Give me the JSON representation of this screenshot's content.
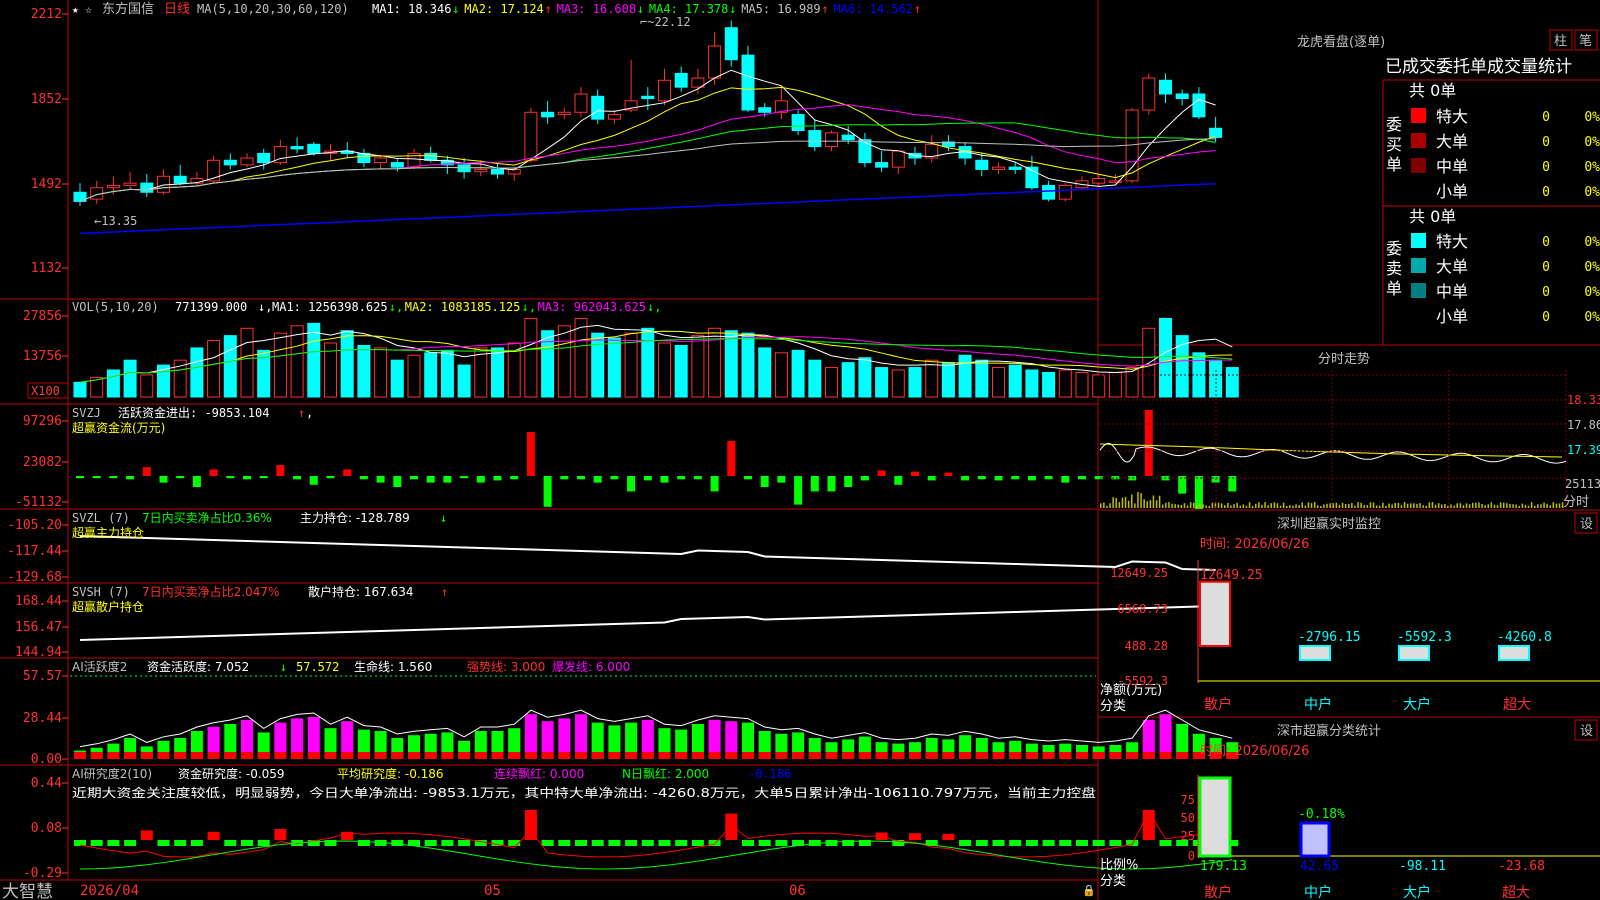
{
  "main_chart": {
    "stock_name": "东方国信",
    "period": "日线",
    "ma_params": "MA(5,10,20,30,60,120)",
    "ma_readouts": [
      {
        "label": "MA1: 18.346",
        "arrow": "↓",
        "color": "#ffffff"
      },
      {
        "label": "MA2: 17.124",
        "arrow": "↑",
        "color": "#ffff00"
      },
      {
        "label": "MA3: 16.608",
        "arrow": "↓",
        "color": "#ff00ff"
      },
      {
        "label": "MA4: 17.378",
        "arrow": "↓",
        "color": "#00ff00"
      },
      {
        "label": "MA5: 16.989",
        "arrow": "↑",
        "color": "#c0c0c0"
      },
      {
        "label": "MA6: 14.562",
        "arrow": "↑",
        "color": "#0000ff"
      }
    ],
    "y_ticks": [
      "2212",
      "1852",
      "1492",
      "1132"
    ],
    "annotation_high": "22.12",
    "annotation_low": "13.35"
  },
  "volume_panel": {
    "title": "VOL(5,10,20)",
    "value": "771399.000",
    "readouts": [
      {
        "label": "MA1: 1256398.625",
        "arrow": "↓",
        "color": "#ffffff"
      },
      {
        "label": "MA2: 1083185.125",
        "arrow": "↓",
        "color": "#ffff00"
      },
      {
        "label": "MA3: 962043.625",
        "arrow": "↓",
        "color": "#ff00ff"
      }
    ],
    "y_ticks": [
      "27856",
      "13756"
    ],
    "unit_badge": "X100"
  },
  "svzj_panel": {
    "title": "SVZJ",
    "label": "活跃资金进出: -9853.104",
    "arrow": "↑",
    "subtitle": "超赢资金流(万元)",
    "y_ticks": [
      "97296",
      "23082",
      "-51132"
    ]
  },
  "svzl_panel": {
    "title": "SVZL (7)",
    "part1": "7日内买卖净占比0.36%",
    "part2": "主力持仓: -128.789",
    "arrow": "↓",
    "subtitle": "超赢主力持仓",
    "y_ticks": [
      "-105.20",
      "-117.44",
      "-129.68"
    ]
  },
  "svsh_panel": {
    "title": "SVSH (7)",
    "part1": "7日内买卖净占比2.047%",
    "part2": "散户持仓: 167.634",
    "arrow": "↑",
    "subtitle": "超赢散户持仓",
    "y_ticks": [
      "168.44",
      "156.47",
      "144.94"
    ]
  },
  "ai_activity_panel": {
    "title": "AI活跃度2",
    "label": "资金活跃度: 7.052",
    "arrow": "↓",
    "value2": "57.572",
    "life_line": "生命线: 1.560",
    "strong_line": "强势线: 3.000",
    "burst_line": "爆发线: 6.000",
    "y_ticks": [
      "57.57",
      "28.44",
      "0.00"
    ]
  },
  "ai_research_panel": {
    "title": "AI研究度2(10)",
    "research": "资金研究度: -0.059",
    "avg": "平均研究度: -0.186",
    "cont": "连续飘红: 0.000",
    "nday": "N日飘红: 2.000",
    "last": "-0.186",
    "commentary": "近期大资金关注度较低，明显弱势，今日大单净流出: -9853.1万元，其中特大单净流出: -4260.8万元，大单5日累计净出-106110.797万元，当前主力控盘",
    "y_ticks": [
      "0.44",
      "0.08",
      "-0.29"
    ]
  },
  "bottom_bar": {
    "brand": "大智慧",
    "date_start": "2026/04",
    "month_05": "05",
    "month_06": "06"
  },
  "right_panel": {
    "lhb_title": "龙虎看盘(逐单)",
    "btn_bar": "柱",
    "btn_pen": "笔",
    "tab_header": "已成交委托单成交量统计",
    "buy_side_label": "委买单",
    "sell_side_label": "委卖单",
    "buy_total": "共 0单",
    "sell_total": "共 0单",
    "buy_rows": [
      {
        "name": "特大",
        "count": "0",
        "pct": "0%",
        "color": "#ff0000"
      },
      {
        "name": "大单",
        "count": "0",
        "pct": "0%",
        "color": "#aa0000"
      },
      {
        "name": "中单",
        "count": "0",
        "pct": "0%",
        "color": "#800000"
      },
      {
        "name": "小单",
        "count": "0",
        "pct": "0%",
        "color": "#000000"
      }
    ],
    "sell_rows": [
      {
        "name": "特大",
        "count": "0",
        "pct": "0%",
        "color": "#00ffff"
      },
      {
        "name": "大单",
        "count": "0",
        "pct": "0%",
        "color": "#00aaaa"
      },
      {
        "name": "中单",
        "count": "0",
        "pct": "0%",
        "color": "#008080"
      },
      {
        "name": "小单",
        "count": "0",
        "pct": "0%",
        "color": "#000000"
      }
    ],
    "intraday_title": "分时走势",
    "intraday_price_ticks": [
      "18.33",
      "17.86",
      "17.39"
    ],
    "intraday_vol_tick": "25113",
    "intraday_unit": "分时",
    "sz_monitor_title": "深圳超赢实时监控",
    "settings_btn": "设",
    "sz_monitor_time": "时间: 2026/06/26",
    "sz_y_ticks": [
      "12649.25",
      "6568.73",
      "488.28",
      "-5592.3"
    ],
    "sz_axis_label_1": "净额(万元)",
    "sz_axis_label_2": "分类",
    "sz_categories": [
      "散户",
      "中户",
      "大户",
      "超大"
    ],
    "sz_values": [
      "12649.25",
      "-2796.15",
      "-5592.3",
      "-4260.8"
    ],
    "cls_title": "深市超赢分类统计",
    "cls_time": "时间: 2026/06/26",
    "cls_y_ticks": [
      "75",
      "50",
      "25",
      "0"
    ],
    "cls_axis_label_1": "比例%",
    "cls_axis_label_2": "分类",
    "cls_value_labels": [
      "179.13",
      "42.65",
      "-98.11",
      "-23.68"
    ],
    "cls_mid_label": "-0.18%"
  },
  "chart_data": {
    "type": "candlestick",
    "candles": [
      {
        "o": 14.6,
        "h": 15.0,
        "c": 14.2,
        "l": 14.0
      },
      {
        "o": 14.3,
        "h": 15.1,
        "c": 14.8,
        "l": 14.1
      },
      {
        "o": 14.8,
        "h": 15.3,
        "c": 14.9,
        "l": 14.5
      },
      {
        "o": 14.9,
        "h": 15.5,
        "c": 15.0,
        "l": 14.7
      },
      {
        "o": 15.0,
        "h": 15.4,
        "c": 14.6,
        "l": 14.4
      },
      {
        "o": 14.6,
        "h": 15.6,
        "c": 15.3,
        "l": 14.5
      },
      {
        "o": 15.3,
        "h": 15.8,
        "c": 15.0,
        "l": 14.9
      },
      {
        "o": 15.0,
        "h": 15.5,
        "c": 15.2,
        "l": 14.9
      },
      {
        "o": 15.1,
        "h": 16.2,
        "c": 16.0,
        "l": 15.0
      },
      {
        "o": 16.0,
        "h": 16.3,
        "c": 15.8,
        "l": 15.6
      },
      {
        "o": 15.8,
        "h": 16.3,
        "c": 16.1,
        "l": 15.7
      },
      {
        "o": 16.3,
        "h": 16.5,
        "c": 15.9,
        "l": 15.6
      },
      {
        "o": 15.9,
        "h": 16.9,
        "c": 16.6,
        "l": 15.8
      },
      {
        "o": 16.6,
        "h": 17.0,
        "c": 16.5,
        "l": 16.3
      },
      {
        "o": 16.7,
        "h": 16.8,
        "c": 16.3,
        "l": 16.2
      },
      {
        "o": 16.3,
        "h": 16.7,
        "c": 16.4,
        "l": 16.0
      },
      {
        "o": 16.4,
        "h": 16.8,
        "c": 16.3,
        "l": 16.1
      },
      {
        "o": 16.3,
        "h": 16.5,
        "c": 15.9,
        "l": 15.7
      },
      {
        "o": 15.9,
        "h": 16.2,
        "c": 16.1,
        "l": 15.6
      },
      {
        "o": 15.9,
        "h": 16.1,
        "c": 15.7,
        "l": 15.5
      },
      {
        "o": 15.7,
        "h": 16.5,
        "c": 16.3,
        "l": 15.6
      },
      {
        "o": 16.3,
        "h": 16.6,
        "c": 16.0,
        "l": 15.9
      },
      {
        "o": 16.0,
        "h": 16.2,
        "c": 15.8,
        "l": 15.4
      },
      {
        "o": 15.8,
        "h": 16.1,
        "c": 15.5,
        "l": 15.2
      },
      {
        "o": 15.5,
        "h": 16.0,
        "c": 15.6,
        "l": 15.3
      },
      {
        "o": 15.6,
        "h": 15.9,
        "c": 15.4,
        "l": 15.2
      },
      {
        "o": 15.4,
        "h": 15.7,
        "c": 15.6,
        "l": 15.1
      },
      {
        "o": 16.0,
        "h": 18.3,
        "c": 18.1,
        "l": 15.9
      },
      {
        "o": 18.1,
        "h": 18.6,
        "c": 17.9,
        "l": 17.6
      },
      {
        "o": 18.0,
        "h": 18.3,
        "c": 18.1,
        "l": 17.8
      },
      {
        "o": 18.1,
        "h": 19.2,
        "c": 18.9,
        "l": 17.9
      },
      {
        "o": 18.8,
        "h": 19.1,
        "c": 17.8,
        "l": 17.6
      },
      {
        "o": 17.8,
        "h": 18.2,
        "c": 18.0,
        "l": 17.6
      },
      {
        "o": 18.2,
        "h": 20.4,
        "c": 18.6,
        "l": 18.1
      },
      {
        "o": 18.8,
        "h": 19.2,
        "c": 18.7,
        "l": 18.2
      },
      {
        "o": 18.6,
        "h": 20.0,
        "c": 19.5,
        "l": 18.4
      },
      {
        "o": 19.8,
        "h": 20.1,
        "c": 19.2,
        "l": 19.0
      },
      {
        "o": 19.2,
        "h": 20.0,
        "c": 19.6,
        "l": 18.9
      },
      {
        "o": 19.6,
        "h": 21.6,
        "c": 21.0,
        "l": 19.3
      },
      {
        "o": 21.8,
        "h": 22.12,
        "c": 20.4,
        "l": 20.1
      },
      {
        "o": 20.6,
        "h": 21.0,
        "c": 18.2,
        "l": 18.1
      },
      {
        "o": 18.3,
        "h": 18.5,
        "c": 18.1,
        "l": 17.9
      },
      {
        "o": 18.1,
        "h": 19.2,
        "c": 18.6,
        "l": 17.8
      },
      {
        "o": 18.0,
        "h": 18.2,
        "c": 17.3,
        "l": 17.1
      },
      {
        "o": 17.3,
        "h": 17.8,
        "c": 16.6,
        "l": 16.4
      },
      {
        "o": 16.6,
        "h": 17.3,
        "c": 17.2,
        "l": 16.4
      },
      {
        "o": 17.1,
        "h": 17.5,
        "c": 16.9,
        "l": 16.7
      },
      {
        "o": 16.9,
        "h": 17.2,
        "c": 15.9,
        "l": 15.7
      },
      {
        "o": 15.9,
        "h": 16.4,
        "c": 15.7,
        "l": 15.5
      },
      {
        "o": 15.7,
        "h": 16.2,
        "c": 16.4,
        "l": 15.4
      },
      {
        "o": 16.3,
        "h": 16.6,
        "c": 16.1,
        "l": 15.8
      },
      {
        "o": 16.1,
        "h": 17.1,
        "c": 16.7,
        "l": 15.9
      },
      {
        "o": 16.8,
        "h": 17.1,
        "c": 16.6,
        "l": 16.4
      },
      {
        "o": 16.6,
        "h": 16.8,
        "c": 16.1,
        "l": 15.8
      },
      {
        "o": 16.0,
        "h": 16.3,
        "c": 15.6,
        "l": 15.3
      },
      {
        "o": 15.6,
        "h": 15.9,
        "c": 15.7,
        "l": 15.4
      },
      {
        "o": 15.7,
        "h": 15.9,
        "c": 15.6,
        "l": 15.4
      },
      {
        "o": 15.7,
        "h": 16.2,
        "c": 14.8,
        "l": 14.7
      },
      {
        "o": 14.9,
        "h": 15.1,
        "c": 14.3,
        "l": 14.2
      },
      {
        "o": 14.3,
        "h": 15.0,
        "c": 14.9,
        "l": 14.2
      },
      {
        "o": 14.8,
        "h": 15.3,
        "c": 15.1,
        "l": 14.7
      },
      {
        "o": 15.0,
        "h": 15.4,
        "c": 15.2,
        "l": 14.9
      },
      {
        "o": 15.1,
        "h": 15.4,
        "c": 15.1,
        "l": 14.9
      },
      {
        "o": 15.1,
        "h": 18.3,
        "c": 18.2,
        "l": 15.0
      },
      {
        "o": 18.2,
        "h": 19.8,
        "c": 19.6,
        "l": 18.0
      },
      {
        "o": 19.5,
        "h": 19.8,
        "c": 18.9,
        "l": 18.5
      },
      {
        "o": 18.9,
        "h": 19.1,
        "c": 18.7,
        "l": 18.4
      },
      {
        "o": 18.9,
        "h": 19.2,
        "c": 17.9,
        "l": 17.8
      },
      {
        "o": 17.4,
        "h": 17.9,
        "c": 17.0,
        "l": 16.8
      }
    ],
    "volume": [
      60,
      80,
      110,
      150,
      90,
      130,
      150,
      200,
      230,
      250,
      280,
      190,
      260,
      290,
      300,
      220,
      270,
      210,
      200,
      150,
      170,
      180,
      190,
      130,
      200,
      200,
      220,
      320,
      270,
      290,
      320,
      260,
      240,
      260,
      280,
      220,
      210,
      250,
      280,
      270,
      260,
      200,
      180,
      190,
      150,
      120,
      140,
      160,
      120,
      110,
      120,
      150,
      140,
      170,
      150,
      120,
      130,
      110,
      100,
      110,
      100,
      90,
      100,
      120,
      280,
      320,
      250,
      180,
      150,
      120
    ],
    "volume_up": [
      0,
      1,
      0,
      0,
      1,
      0,
      1,
      0,
      1,
      0,
      1,
      0,
      1,
      1,
      0,
      1,
      0,
      0,
      1,
      0,
      1,
      0,
      0,
      0,
      1,
      0,
      1,
      1,
      0,
      1,
      1,
      0,
      0,
      1,
      0,
      1,
      0,
      1,
      1,
      0,
      0,
      0,
      1,
      0,
      0,
      1,
      0,
      0,
      0,
      1,
      0,
      1,
      0,
      0,
      0,
      1,
      0,
      0,
      0,
      1,
      1,
      1,
      1,
      1,
      1,
      0,
      0,
      0,
      0,
      0
    ],
    "svzj": [
      -2,
      -2,
      -2,
      -3,
      8,
      -6,
      -2,
      -10,
      6,
      -2,
      -3,
      -2,
      10,
      -3,
      -8,
      -2,
      6,
      -3,
      -6,
      -10,
      -3,
      -6,
      -6,
      -2,
      -6,
      -4,
      -3,
      40,
      -28,
      -3,
      -3,
      -6,
      -3,
      -14,
      -4,
      -6,
      -3,
      -3,
      -14,
      32,
      -3,
      -10,
      -6,
      -26,
      -14,
      -14,
      -10,
      -4,
      5,
      -8,
      4,
      -4,
      3,
      -4,
      -3,
      -4,
      -3,
      -4,
      -3,
      -6,
      -3,
      -3,
      -3,
      -4,
      60,
      -4,
      -16,
      -30,
      -6,
      -14
    ],
    "x_labels": [
      "2026/04",
      "05",
      "06"
    ]
  }
}
